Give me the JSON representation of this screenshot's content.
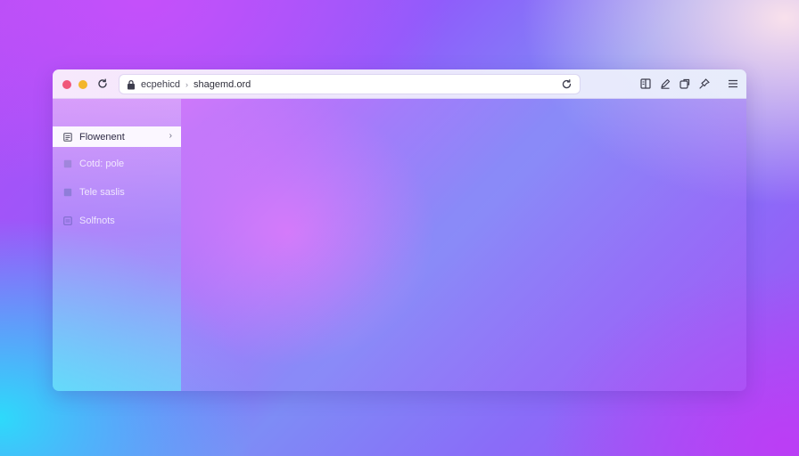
{
  "window": {
    "url": {
      "prefix": "ecpehicd",
      "separator": "›",
      "host": "shagemd.ord"
    }
  },
  "sidebar": {
    "items": [
      {
        "label": "Flowenent",
        "icon": "document-icon",
        "active": true
      },
      {
        "label": "Cotd: pole",
        "icon": "square-icon",
        "active": false
      },
      {
        "label": "Tele saslis",
        "icon": "square-icon",
        "active": false
      },
      {
        "label": "Solfnots",
        "icon": "image-icon",
        "active": false
      }
    ]
  },
  "toolbar": {
    "icons": [
      "reader-icon",
      "edit-icon",
      "extension-icon",
      "pin-icon",
      "menu-icon"
    ]
  },
  "colors": {
    "close": "#f0567a",
    "minimize": "#f3b62c"
  }
}
